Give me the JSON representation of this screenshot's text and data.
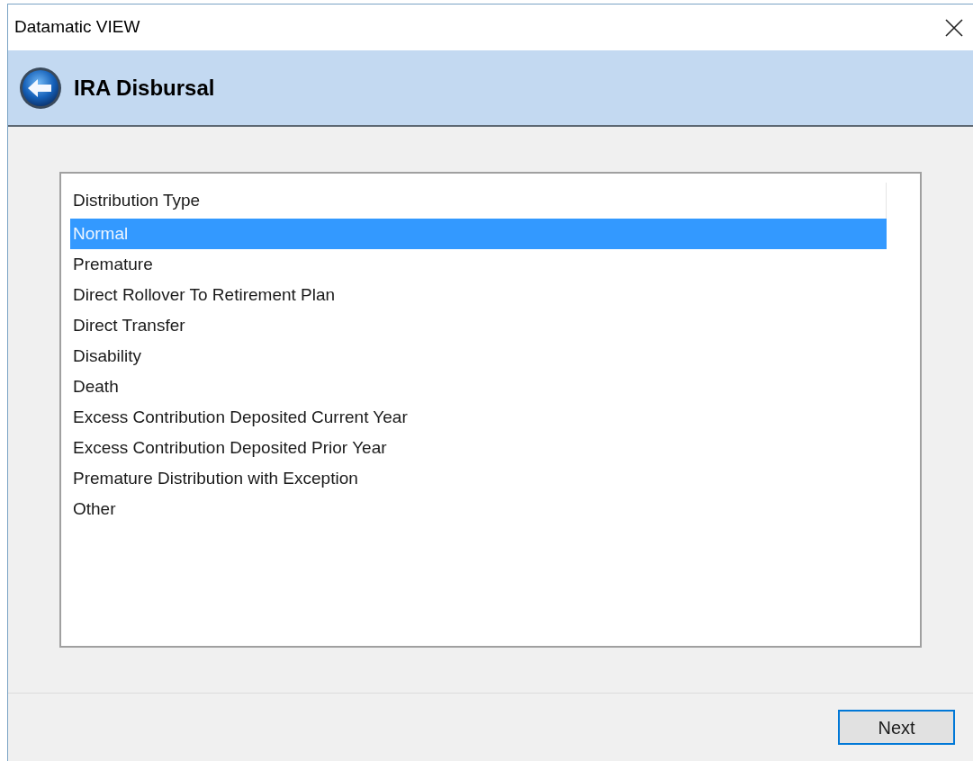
{
  "window": {
    "title": "Datamatic VIEW"
  },
  "header": {
    "title": "IRA Disbursal"
  },
  "list": {
    "column": "Distribution Type",
    "items": [
      {
        "label": "Normal",
        "selected": true
      },
      {
        "label": "Premature",
        "selected": false
      },
      {
        "label": "Direct Rollover To Retirement Plan",
        "selected": false
      },
      {
        "label": "Direct Transfer",
        "selected": false
      },
      {
        "label": "Disability",
        "selected": false
      },
      {
        "label": "Death",
        "selected": false
      },
      {
        "label": "Excess Contribution Deposited Current Year",
        "selected": false
      },
      {
        "label": "Excess Contribution Deposited Prior Year",
        "selected": false
      },
      {
        "label": "Premature Distribution with Exception",
        "selected": false
      },
      {
        "label": "Other",
        "selected": false
      }
    ]
  },
  "buttons": [
    {
      "label": "Next"
    }
  ]
}
